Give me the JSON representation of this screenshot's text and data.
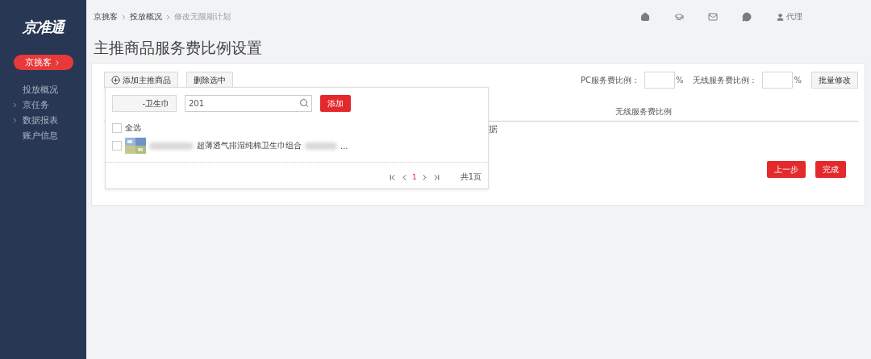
{
  "sidebar": {
    "logo": "京准通",
    "badge": "京挑客",
    "items": [
      {
        "label": "投放概况",
        "expandable": false
      },
      {
        "label": "京任务",
        "expandable": true
      },
      {
        "label": "数据报表",
        "expandable": true
      },
      {
        "label": "账户信息",
        "expandable": false
      }
    ]
  },
  "breadcrumb": [
    "京挑客",
    "投放概况",
    "修改无限期计划"
  ],
  "user": "代理",
  "title": "主推商品服务费比例设置",
  "toolbar": {
    "buttons": [
      {
        "label": "添加主推商品",
        "kind": "add"
      },
      {
        "label": "删除选中",
        "kind": "plain"
      }
    ],
    "ratio_fields": [
      {
        "label": "PC服务费比例：",
        "unit": "%"
      },
      {
        "label": "无线服务费比例：",
        "unit": "%"
      }
    ],
    "batch_button": "批量修改"
  },
  "table": {
    "column_header": "无线服务费比例",
    "cell_fragment": "据"
  },
  "popover": {
    "category": "-卫生巾",
    "search_value": "201",
    "add_button": "添加",
    "select_all": {
      "label": "全选",
      "checked": false
    },
    "products": [
      {
        "title": "超薄透气排湿纯棉卫生巾组合",
        "suffix": "...",
        "checked": false
      }
    ],
    "pagination": {
      "page": "1",
      "total": "共1页"
    }
  },
  "footer_buttons": [
    "上一步",
    "完成"
  ]
}
